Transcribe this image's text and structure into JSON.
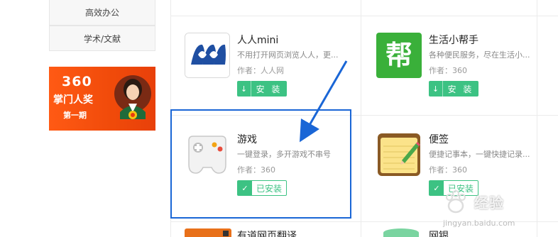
{
  "sidebar": {
    "items": [
      {
        "label": "高效办公"
      },
      {
        "label": "学术/文献"
      }
    ],
    "banner": {
      "number": "360",
      "title": "掌门人奖",
      "subtitle": "第一期"
    }
  },
  "apps": [
    {
      "name": "人人mini",
      "desc": "不用打开网页浏览人人，更...",
      "author": "作者：人人网",
      "button": "安 装",
      "state": "install",
      "icon": "renren-icon"
    },
    {
      "name": "生活小帮手",
      "desc": "各种便民服务，尽在生活小...",
      "author": "作者：360",
      "button": "安 装",
      "state": "install",
      "icon": "bang-icon",
      "icon_text": "帮"
    },
    {
      "name": "游戏",
      "desc": "一键登录，多开游戏不串号",
      "author": "作者：360",
      "button": "已安装",
      "state": "installed",
      "icon": "gamepad-icon"
    },
    {
      "name": "便签",
      "desc": "便捷记事本，一键快捷记录...",
      "author": "作者：360",
      "button": "已安装",
      "state": "installed",
      "icon": "notepad-icon"
    }
  ],
  "partial_row": [
    {
      "name": "有道网页翻译"
    },
    {
      "name": "网银"
    }
  ],
  "watermark": {
    "text": "经验",
    "url": "jingyan.baidu.com"
  },
  "colors": {
    "install": "#3cc283",
    "highlight": "#1a66d6",
    "banner": "#f04a0a",
    "bang_bg": "#3ab03a"
  }
}
